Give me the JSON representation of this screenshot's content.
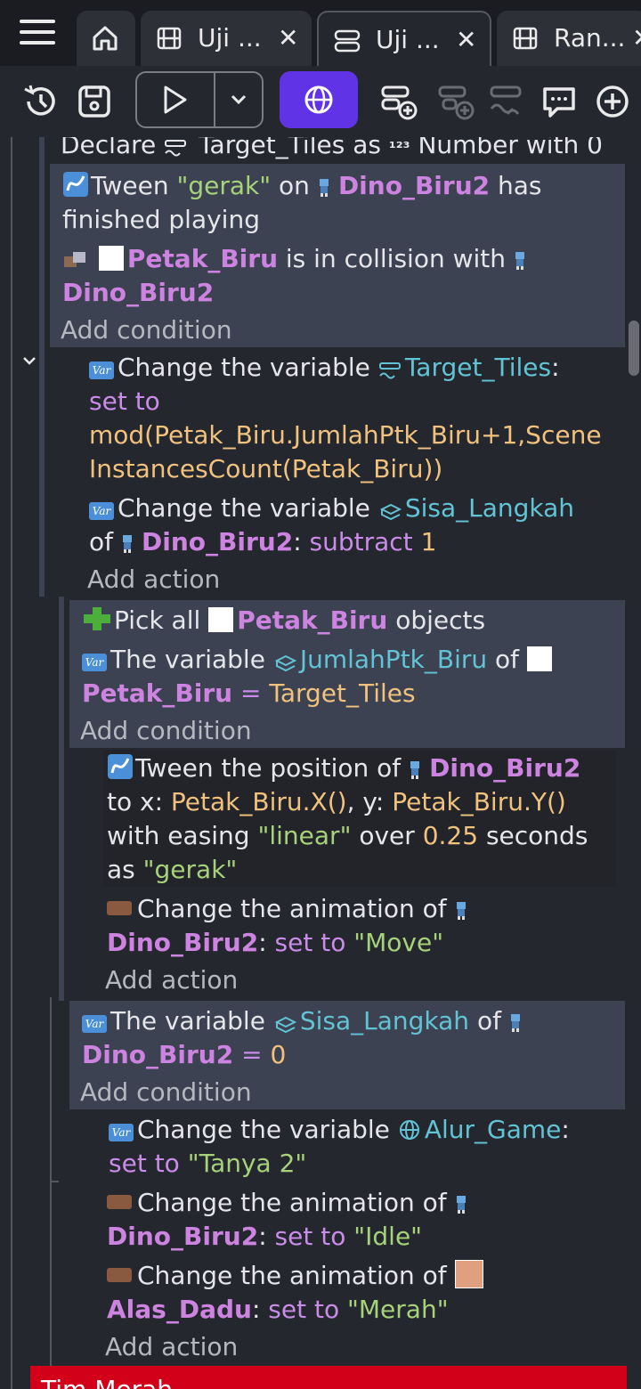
{
  "tabs": [
    {
      "label": "Uji ...",
      "close": "✕"
    },
    {
      "label": "Uji ...",
      "close": "✕"
    },
    {
      "label": "Ran...",
      "close": "✕"
    }
  ],
  "sheet": {
    "declare": {
      "pre": "Declare",
      "var": "Target_Tiles",
      "mid": "as",
      "type_glyph": "¹²³",
      "type": "Number",
      "post": "with 0"
    },
    "cond1": {
      "tween": {
        "pre": "Tween",
        "str": "\"gerak\"",
        "on": "on",
        "obj": "Dino_Biru2",
        "post1": "has",
        "post2": "finished playing"
      },
      "collision": {
        "obj1": "Petak_Biru",
        "mid": "is in collision with",
        "obj2": "Dino_Biru2"
      },
      "add_condition": "Add condition"
    },
    "act1": {
      "change_target": {
        "pre": "Change the variable",
        "var": "Target_Tiles",
        "colon": ":",
        "op": "set to",
        "expr1": "mod(Petak_Biru.JumlahPtk_Biru+1,Scene",
        "expr2": "InstancesCount(Petak_Biru))"
      },
      "change_sisa": {
        "pre": "Change the variable",
        "var": "Sisa_Langkah",
        "of": "of",
        "obj": "Dino_Biru2",
        "colon": ":",
        "op": "subtract",
        "num": "1"
      },
      "add_action": "Add action"
    },
    "cond2": {
      "pick": {
        "pre": "Pick all",
        "obj": "Petak_Biru",
        "post": "objects"
      },
      "variable": {
        "pre": "The variable",
        "var": "JumlahPtk_Biru",
        "of": "of",
        "obj": "Petak_Biru",
        "op": "=",
        "val": "Target_Tiles"
      },
      "add_condition": "Add condition"
    },
    "act2": {
      "tween": {
        "pre": "Tween the position of",
        "obj": "Dino_Biru2",
        "l2a": "to x:",
        "x": "Petak_Biru.X()",
        "l2b": ", y:",
        "y": "Petak_Biru.Y()",
        "l3a": "with easing",
        "easing": "\"linear\"",
        "l3b": "over",
        "secs": "0.25",
        "l3c": "seconds",
        "l4a": "as",
        "name": "\"gerak\""
      },
      "anim": {
        "pre": "Change the animation of",
        "obj": "Dino_Biru2",
        "colon": ":",
        "op": "set to",
        "str": "\"Move\""
      },
      "add_action": "Add action"
    },
    "cond3": {
      "variable": {
        "pre": "The variable",
        "var": "Sisa_Langkah",
        "of": "of",
        "obj": "Dino_Biru2",
        "op": "=",
        "val": "0"
      },
      "add_condition": "Add condition"
    },
    "act3": {
      "change_alur": {
        "pre": "Change the variable",
        "var": "Alur_Game",
        "colon": ":",
        "op": "set to",
        "str": "\"Tanya 2\""
      },
      "anim_idle": {
        "pre": "Change the animation of",
        "obj": "Dino_Biru2",
        "colon": ":",
        "op": "set to",
        "str": "\"Idle\""
      },
      "anim_merah": {
        "pre": "Change the animation of",
        "obj": "Alas_Dadu",
        "colon": ":",
        "op": "set to",
        "str": "\"Merah\""
      },
      "add_action": "Add action"
    },
    "bottom_comment": "Tim Merah"
  },
  "colors": {
    "accent": "#6034e6",
    "condition_bg": "#3c4252",
    "object": "#cd84e0",
    "variable": "#62c3d4",
    "string": "#a6d27a",
    "number": "#f1c27d",
    "comment_red": "#d3001a"
  }
}
